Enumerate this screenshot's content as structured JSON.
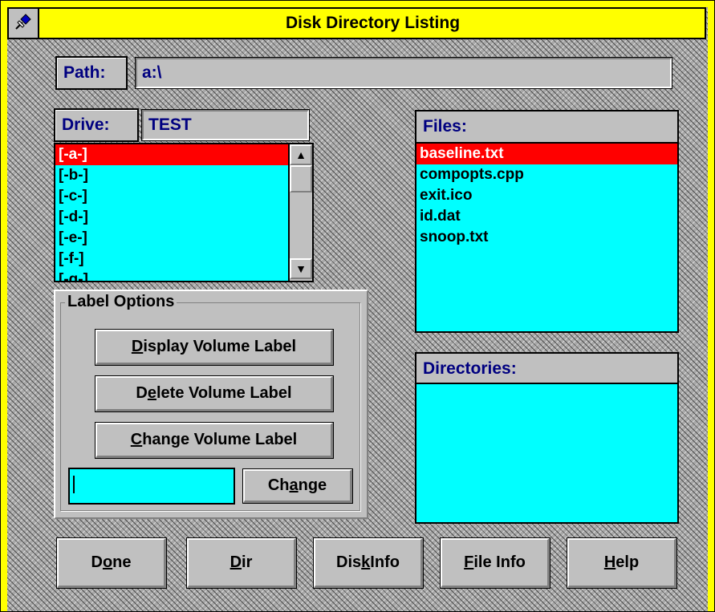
{
  "window": {
    "title": "Disk Directory Listing",
    "system_icon": "pushpin-icon",
    "colors": {
      "titlebar": "#ffff00",
      "list_bg": "#00ffff",
      "selection": "#ff0000",
      "label_text": "#000080"
    }
  },
  "path": {
    "label": "Path:",
    "value": "a:\\"
  },
  "drive": {
    "label": "Drive:",
    "value": "TEST",
    "items": [
      "[-a-]",
      "[-b-]",
      "[-c-]",
      "[-d-]",
      "[-e-]",
      "[-f-]",
      "[-g-]"
    ],
    "selected_index": 0
  },
  "files": {
    "label": "Files:",
    "items": [
      "baseline.txt",
      "compopts.cpp",
      "exit.ico",
      "id.dat",
      "snoop.txt"
    ],
    "selected_index": 0
  },
  "directories": {
    "label": "Directories:",
    "items": []
  },
  "label_options": {
    "title": "Label Options",
    "display_button": {
      "mnemonic": "D",
      "rest": "isplay Volume Label"
    },
    "delete_button": {
      "pre": "D",
      "mnemonic": "e",
      "rest": "lete Volume Label"
    },
    "change_label_button": {
      "mnemonic": "C",
      "rest": "hange Volume Label"
    },
    "new_label_value": "",
    "change_button": {
      "pre": "Ch",
      "mnemonic": "a",
      "rest": "nge"
    }
  },
  "bottom_buttons": {
    "done": {
      "pre": "D",
      "mnemonic": "o",
      "rest": "ne"
    },
    "dir": {
      "pre": "",
      "mnemonic": "D",
      "rest": "ir"
    },
    "disk_info": {
      "pre": "Dis",
      "mnemonic": "k",
      "rest": " Info"
    },
    "file_info": {
      "pre": "",
      "mnemonic": "F",
      "rest": "ile Info"
    },
    "help": {
      "pre": "",
      "mnemonic": "H",
      "rest": "elp"
    }
  }
}
